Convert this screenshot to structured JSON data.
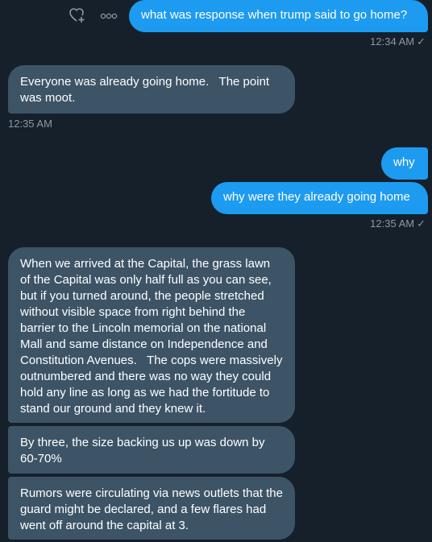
{
  "conversation": {
    "messages": [
      {
        "side": "out",
        "text": "what was response when trump said to go home?"
      },
      {
        "side": "out_time",
        "time": "12:34 AM",
        "status": "✓"
      },
      {
        "side": "in",
        "text": "Everyone was already going home.   The point was moot."
      },
      {
        "side": "in_time",
        "time": "12:35 AM"
      },
      {
        "side": "out",
        "text": "why"
      },
      {
        "side": "out",
        "text": "why were they already going home"
      },
      {
        "side": "out_time",
        "time": "12:35 AM",
        "status": "✓"
      },
      {
        "side": "in",
        "text": "When we arrived at the Capital, the grass lawn of the Capital was only half full as you can see, but if you turned around, the people stretched without visible space from right behind the barrier to the Lincoln memorial on the national Mall and same distance on Independence and Constitution Avenues.   The cops were massively outnumbered and there was no way they could hold any line as long as we had the fortitude to stand our ground and they knew it."
      },
      {
        "side": "in",
        "text": "By three, the size backing us up was down by 60-70%"
      },
      {
        "side": "in",
        "text": "Rumors were circulating via news outlets that the guard might be declared, and a few flares had went off around the capital at 3."
      }
    ]
  },
  "icons": {
    "react": "heart-add-icon",
    "more": "more-options-icon"
  },
  "colors": {
    "background": "#15202b",
    "outgoing_bubble": "#1d9bf0",
    "incoming_bubble": "#3d5466",
    "timestamp": "#8b98a5"
  }
}
